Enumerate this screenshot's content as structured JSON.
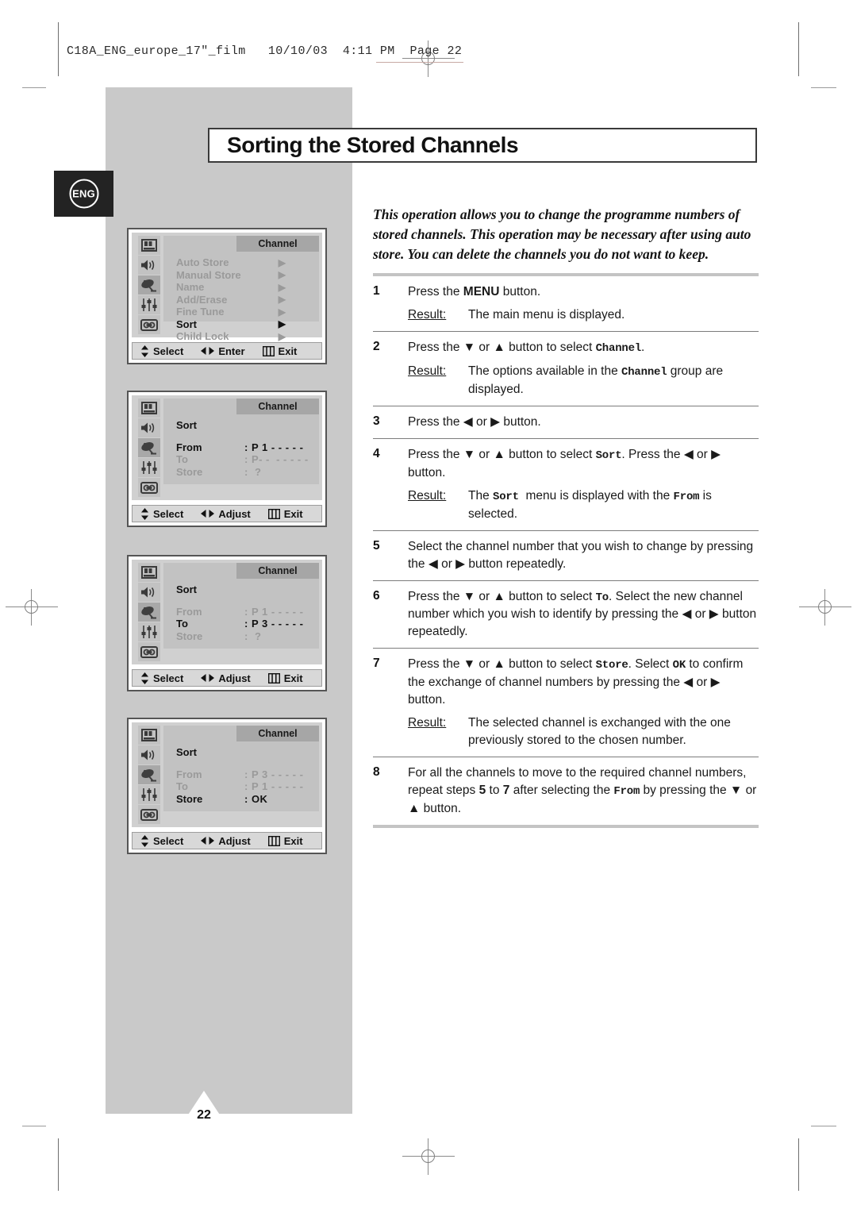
{
  "print_slug": {
    "text": "C18A_ENG_europe_17\"_film   10/10/03  4:11 PM  Page 22"
  },
  "language_badge": {
    "label": "ENG"
  },
  "header": {
    "title": "Sorting the Stored Channels"
  },
  "intro": {
    "text": "This operation allows you to change the programme numbers of stored channels. This operation may be necessary after using auto store. You can delete the channels you do not want to keep."
  },
  "page_footer": {
    "page_number": "22"
  },
  "osd_screens": [
    {
      "name": "channel-menu",
      "tab_label": "Channel",
      "selected_icon_index": 2,
      "rows": [
        {
          "label": "Auto Store",
          "arrow": "▶",
          "value": "",
          "active": false
        },
        {
          "label": "Manual Store",
          "arrow": "▶",
          "value": "",
          "active": false
        },
        {
          "label": "Name",
          "arrow": "▶",
          "value": "",
          "active": false
        },
        {
          "label": "Add/Erase",
          "arrow": "▶",
          "value": "",
          "active": false
        },
        {
          "label": "Fine Tune",
          "arrow": "▶",
          "value": "",
          "active": false
        },
        {
          "label": "Sort",
          "arrow": "▶",
          "value": "",
          "active": true
        },
        {
          "label": "Child Lock",
          "arrow": "▶",
          "value": "",
          "active": false
        }
      ],
      "nav": [
        {
          "icon": "up-down-arrows-icon",
          "label": "Select"
        },
        {
          "icon": "left-right-arrows-icon",
          "label": "Enter"
        },
        {
          "icon": "menu-bars-icon",
          "label": "Exit"
        }
      ]
    },
    {
      "name": "sort-from-selected",
      "tab_label": "Channel",
      "selected_icon_index": 2,
      "heading": {
        "label": "Sort",
        "active": true
      },
      "rows": [
        {
          "label": "From",
          "value": ": P 1 - - - - -",
          "active": true
        },
        {
          "label": "To",
          "value": ": P- -  - - - - -",
          "active": false
        },
        {
          "label": "Store",
          "value": ":  ?",
          "active": false
        }
      ],
      "nav": [
        {
          "icon": "up-down-arrows-icon",
          "label": "Select"
        },
        {
          "icon": "left-right-arrows-icon",
          "label": "Adjust"
        },
        {
          "icon": "menu-bars-icon",
          "label": "Exit"
        }
      ]
    },
    {
      "name": "sort-to-selected",
      "tab_label": "Channel",
      "selected_icon_index": 2,
      "heading": {
        "label": "Sort",
        "active": true
      },
      "rows": [
        {
          "label": "From",
          "value": ": P 1 - - - - -",
          "active": false
        },
        {
          "label": "To",
          "value": ": P 3 - - - - -",
          "active": true
        },
        {
          "label": "Store",
          "value": ":  ?",
          "active": false
        }
      ],
      "nav": [
        {
          "icon": "up-down-arrows-icon",
          "label": "Select"
        },
        {
          "icon": "left-right-arrows-icon",
          "label": "Adjust"
        },
        {
          "icon": "menu-bars-icon",
          "label": "Exit"
        }
      ]
    },
    {
      "name": "sort-store-ok",
      "tab_label": "Channel",
      "selected_icon_index": 2,
      "heading": {
        "label": "Sort",
        "active": true
      },
      "rows": [
        {
          "label": "From",
          "value": ": P 3 - - - - -",
          "active": false
        },
        {
          "label": "To",
          "value": ": P 1 - - - - -",
          "active": false
        },
        {
          "label": "Store",
          "value": ": OK",
          "active": true
        }
      ],
      "nav": [
        {
          "icon": "up-down-arrows-icon",
          "label": "Select"
        },
        {
          "icon": "left-right-arrows-icon",
          "label": "Adjust"
        },
        {
          "icon": "menu-bars-icon",
          "label": "Exit"
        }
      ]
    }
  ],
  "osd_icon_names": [
    "picture-icon",
    "sound-speaker-icon",
    "channel-satellite-dish-icon",
    "setup-sliders-icon",
    "function-vcr-icon"
  ],
  "steps": [
    {
      "number": "1",
      "instruction_html": "Press the <b>MENU</b> button.",
      "result_label": "Result:",
      "result_html": "The main menu is displayed."
    },
    {
      "number": "2",
      "instruction_html": "Press the ▼ or ▲ button to select <code>Channel</code>.",
      "result_label": "Result:",
      "result_html": "The options available in the <code>Channel</code> group are displayed."
    },
    {
      "number": "3",
      "instruction_html": "Press the ◀ or ▶ button.",
      "result_label": "",
      "result_html": ""
    },
    {
      "number": "4",
      "instruction_html": "Press the ▼ or ▲ button to select <code>Sort</code>. Press the ◀ or ▶ button.",
      "result_label": "Result:",
      "result_html": "The <code>Sort</code>&nbsp; menu is displayed with the <code>From</code> is selected."
    },
    {
      "number": "5",
      "instruction_html": "Select the channel number that you wish to change by pressing the ◀ or ▶ button repeatedly.",
      "result_label": "",
      "result_html": ""
    },
    {
      "number": "6",
      "instruction_html": "Press the ▼ or ▲ button to select <code>To</code>. Select the new channel number which you wish to identify by pressing the ◀ or ▶ button repeatedly.",
      "result_label": "",
      "result_html": ""
    },
    {
      "number": "7",
      "instruction_html": "Press the ▼ or ▲ button to select <code>Store</code>. Select <code>OK</code> to confirm the exchange of channel numbers by pressing the ◀ or ▶ button.",
      "result_label": "Result:",
      "result_html": "The selected channel is exchanged with the one previously stored to the chosen number."
    },
    {
      "number": "8",
      "instruction_html": "For all the channels to move to the required channel numbers, repeat steps <b>5</b> to <b>7</b> after selecting the <code>From</code> by pressing the ▼ or ▲ button.",
      "result_label": "",
      "result_html": ""
    }
  ],
  "colors": {
    "panel_gray": "#c9c9c9",
    "osd_body_gray": "#c2c2c2",
    "osd_tab_gray": "#a6a6a6",
    "badge_black": "#232323"
  }
}
